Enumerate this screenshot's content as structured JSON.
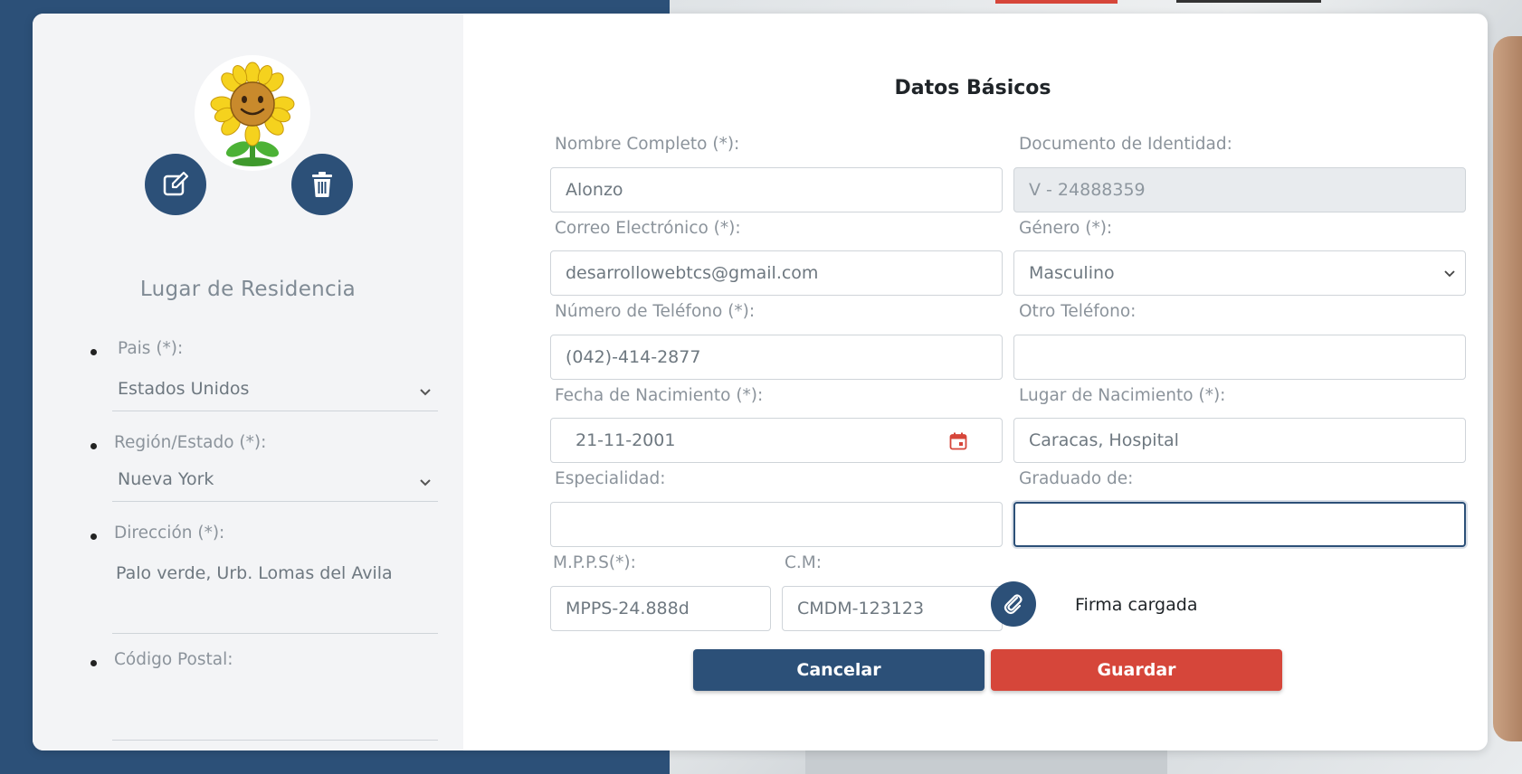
{
  "colors": {
    "primary": "#2c5078",
    "danger": "#d6463a",
    "panel_bg": "#f3f4f6"
  },
  "profile": {
    "avatar_icon": "sunflower-icon",
    "edit_icon": "edit-icon",
    "delete_icon": "trash-icon"
  },
  "residence": {
    "title": "Lugar de Residencia",
    "country": {
      "label": "Pais (*):",
      "value": "Estados Unidos"
    },
    "region": {
      "label": "Región/Estado (*):",
      "value": "Nueva York"
    },
    "address": {
      "label": "Dirección (*):",
      "value": "Palo verde, Urb. Lomas del Avila"
    },
    "postal": {
      "label": "Código Postal:",
      "value": ""
    }
  },
  "form": {
    "title": "Datos Básicos",
    "full_name": {
      "label": "Nombre Completo (*):",
      "value": "Alonzo"
    },
    "id_doc": {
      "label": "Documento de Identidad:",
      "value": "V - 24888359"
    },
    "email": {
      "label": "Correo Electrónico (*):",
      "value": "desarrollowebtcs@gmail.com"
    },
    "gender": {
      "label": "Género (*):",
      "value": "Masculino"
    },
    "phone": {
      "label": "Número de Teléfono (*):",
      "value": "(042)-414-2877"
    },
    "other_phone": {
      "label": "Otro Teléfono:",
      "value": ""
    },
    "birth_date": {
      "label": "Fecha de Nacimiento (*):",
      "value": "21-11-2001"
    },
    "birth_place": {
      "label": "Lugar de Nacimiento (*):",
      "value": "Caracas, Hospital"
    },
    "specialty": {
      "label": "Especialidad:",
      "value": ""
    },
    "graduated_from": {
      "label": "Graduado de:",
      "value": ""
    },
    "mpps": {
      "label": "M.P.P.S(*):",
      "value": "MPPS-24.888d"
    },
    "cm": {
      "label": "C.M:",
      "value": "CMDM-123123"
    },
    "signature_status": "Firma cargada"
  },
  "actions": {
    "cancel": "Cancelar",
    "save": "Guardar"
  }
}
